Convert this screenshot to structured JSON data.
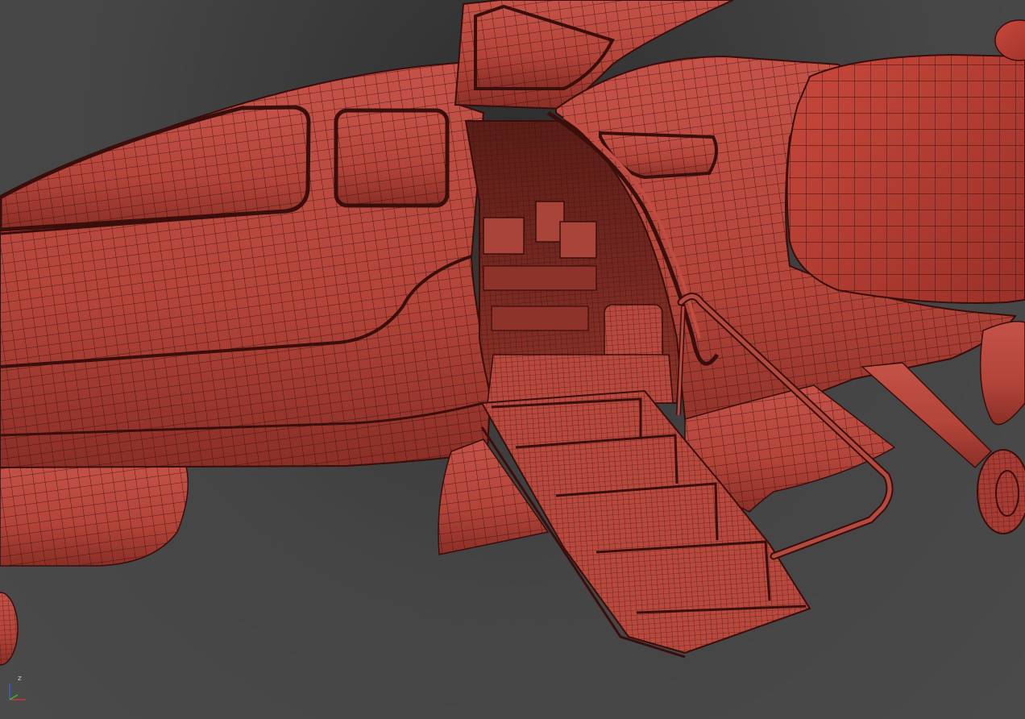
{
  "viewport": {
    "background_color": "#3a3a3a",
    "model_color": "#b5463c",
    "wire_color": "#3a0e0b"
  },
  "axis_gizmo": {
    "z_label": "z",
    "x_color": "#d23232",
    "y_color": "#2fbf2f",
    "z_color": "#3a5fd8"
  }
}
